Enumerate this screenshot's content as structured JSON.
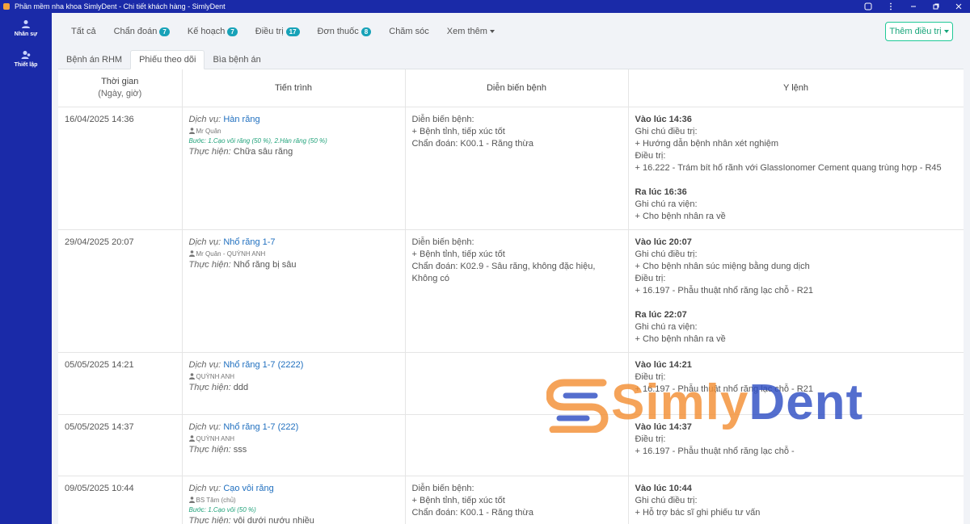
{
  "window": {
    "title": "Phần mềm nha khoa SimlyDent - Chi tiết khách hàng - SimlyDent"
  },
  "sidebar": {
    "items": [
      {
        "label": "Nhân sự",
        "icon": "users-icon"
      },
      {
        "label": "Thiết lập",
        "icon": "settings-users-icon"
      }
    ]
  },
  "top_tabs": [
    {
      "label": "Tất cả",
      "badge": ""
    },
    {
      "label": "Chẩn đoán",
      "badge": "7"
    },
    {
      "label": "Kế hoạch",
      "badge": "7"
    },
    {
      "label": "Điều trị",
      "badge": "17"
    },
    {
      "label": "Đơn thuốc",
      "badge": "8"
    },
    {
      "label": "Chăm sóc",
      "badge": ""
    },
    {
      "label": "Xem thêm",
      "badge": ""
    }
  ],
  "add_button_label": "Thêm điều trị",
  "sub_tabs": [
    {
      "label": "Bệnh án RHM"
    },
    {
      "label": "Phiếu theo dõi"
    },
    {
      "label": "Bìa bệnh án"
    }
  ],
  "table": {
    "headers": {
      "time": "Thời gian",
      "time_sub": "(Ngày, giờ)",
      "progress": "Tiến trình",
      "evolution": "Diễn biến bệnh",
      "orders": "Y lệnh"
    },
    "labels": {
      "service": "Dịch vụ:",
      "perform": "Thực hiện:"
    },
    "rows": [
      {
        "time": "16/04/2025 14:36",
        "service": "Hàn răng",
        "doctor": "Mr Quân",
        "steps": "Bước: 1.Cạo vôi răng (50 %), 2.Hàn răng (50 %)",
        "perform": "Chữa sâu răng",
        "evolution": [
          "Diễn biến bệnh:",
          "+ Bệnh tỉnh, tiếp xúc tốt",
          "Chẩn đoán: K00.1 - Răng thừa"
        ],
        "orders": [
          {
            "head": "Vào lúc 14:36",
            "lines": [
              "Ghi chú điều trị:",
              "+ Hướng dẫn bệnh nhân xét nghiệm",
              "Điều trị:",
              "+ 16.222 - Trám bít hố rãnh với GlassIonomer Cement quang trùng hợp - R45"
            ]
          },
          {
            "head": "Ra lúc 16:36",
            "lines": [
              "Ghi chú ra viện:",
              "+ Cho bệnh nhân ra về"
            ]
          }
        ]
      },
      {
        "time": "29/04/2025 20:07",
        "service": "Nhổ răng 1-7",
        "doctor": "Mr Quân - QUỲNH ANH",
        "steps": "",
        "perform": "Nhổ răng bị sâu",
        "evolution": [
          "Diễn biến bệnh:",
          "+ Bệnh tỉnh, tiếp xúc tốt",
          "Chẩn đoán: K02.9 - Sâu răng, không đặc hiệu, Không có"
        ],
        "orders": [
          {
            "head": "Vào lúc 20:07",
            "lines": [
              "Ghi chú điều trị:",
              "+ Cho bệnh nhân súc miệng bằng dung dịch",
              "Điều trị:",
              "+ 16.197 - Phẫu thuật nhổ răng lạc chỗ - R21"
            ]
          },
          {
            "head": "Ra lúc 22:07",
            "lines": [
              "Ghi chú ra viện:",
              "+ Cho bệnh nhân ra về"
            ]
          }
        ]
      },
      {
        "time": "05/05/2025 14:21",
        "service": "Nhổ răng 1-7 (2222)",
        "doctor": "QUỲNH ANH",
        "steps": "",
        "perform": "ddd",
        "evolution": [],
        "orders": [
          {
            "head": "Vào lúc 14:21",
            "lines": [
              "Điều trị:",
              "+ 16.197 - Phẫu thuật nhổ răng lạc chỗ - R21"
            ]
          }
        ]
      },
      {
        "time": "05/05/2025 14:37",
        "service": "Nhổ răng 1-7 (222)",
        "doctor": "QUỲNH ANH",
        "steps": "",
        "perform": "sss",
        "evolution": [],
        "orders": [
          {
            "head": "Vào lúc 14:37",
            "lines": [
              "Điều trị:",
              "+ 16.197 - Phẫu thuật nhổ răng lạc chỗ -"
            ]
          }
        ]
      },
      {
        "time": "09/05/2025 10:44",
        "service": "Cạo vôi răng",
        "doctor": "BS Tâm (chủ)",
        "steps": "Bước: 1.Cạo vôi (50 %)",
        "perform": "vôi dưới nướu nhiều",
        "evolution": [
          "Diễn biến bệnh:",
          "+ Bệnh tỉnh, tiếp xúc tốt",
          "Chẩn đoán: K00.1 - Răng thừa"
        ],
        "orders": [
          {
            "head": "Vào lúc 10:44",
            "lines": [
              "Ghi chú điều trị:",
              "+ Hỗ trợ bác sĩ ghi phiếu tư vấn"
            ]
          }
        ]
      }
    ]
  },
  "watermark": {
    "part1": "Simly",
    "part2": "Dent"
  },
  "colors": {
    "primary": "#1a2aa8",
    "accent": "#17a2b8",
    "link": "#1f6fbf",
    "brand_orange": "#f39035",
    "brand_blue": "#2f4fc4"
  }
}
